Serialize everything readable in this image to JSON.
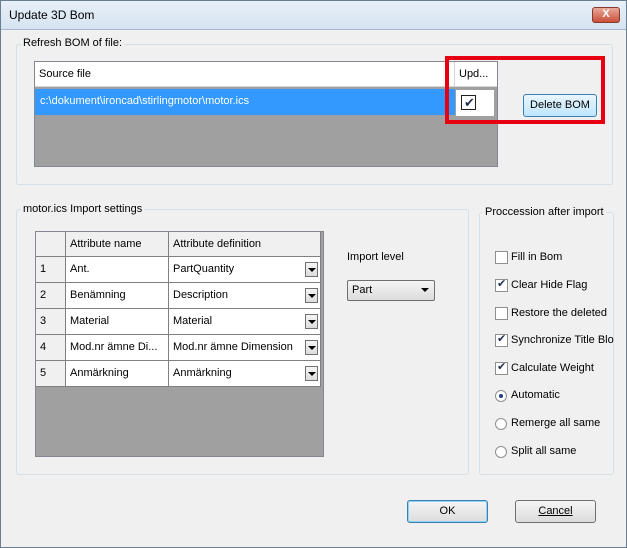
{
  "window": {
    "title": "Update 3D Bom",
    "close_label": "X"
  },
  "refresh_group": {
    "label": "Refresh BOM of file:",
    "columns": [
      "Source file",
      "Upd..."
    ],
    "rows": [
      {
        "source_file": "c:\\dokument\\ironcad\\stirlingmotor\\motor.ics",
        "update_checked": true
      }
    ],
    "delete_button": "Delete BOM"
  },
  "import_group": {
    "label": "motor.ics Import settings",
    "columns": [
      "Attribute name",
      "Attribute definition"
    ],
    "rows": [
      {
        "num": "1",
        "name": "Ant.",
        "definition": "PartQuantity"
      },
      {
        "num": "2",
        "name": "Benämning",
        "definition": "Description"
      },
      {
        "num": "3",
        "name": "Material",
        "definition": "Material"
      },
      {
        "num": "4",
        "name": "Mod.nr ämne Di...",
        "definition": "Mod.nr ämne Dimension"
      },
      {
        "num": "5",
        "name": "Anmärkning",
        "definition": "Anmärkning"
      }
    ],
    "import_level_label": "Import level",
    "import_level_value": "Part"
  },
  "procession_group": {
    "label": "Proccession after import",
    "checkboxes": [
      {
        "label": "Fill in Bom",
        "checked": false
      },
      {
        "label": "Clear Hide Flag",
        "checked": true
      },
      {
        "label": "Restore the deleted",
        "checked": false
      },
      {
        "label": "Synchronize Title Blo",
        "checked": true
      },
      {
        "label": "Calculate Weight",
        "checked": true
      }
    ],
    "radios": [
      {
        "label": "Automatic",
        "checked": true
      },
      {
        "label": "Remerge all same",
        "checked": false
      },
      {
        "label": "Split all same",
        "checked": false
      }
    ]
  },
  "buttons": {
    "ok": "OK",
    "cancel": "Cancel"
  }
}
